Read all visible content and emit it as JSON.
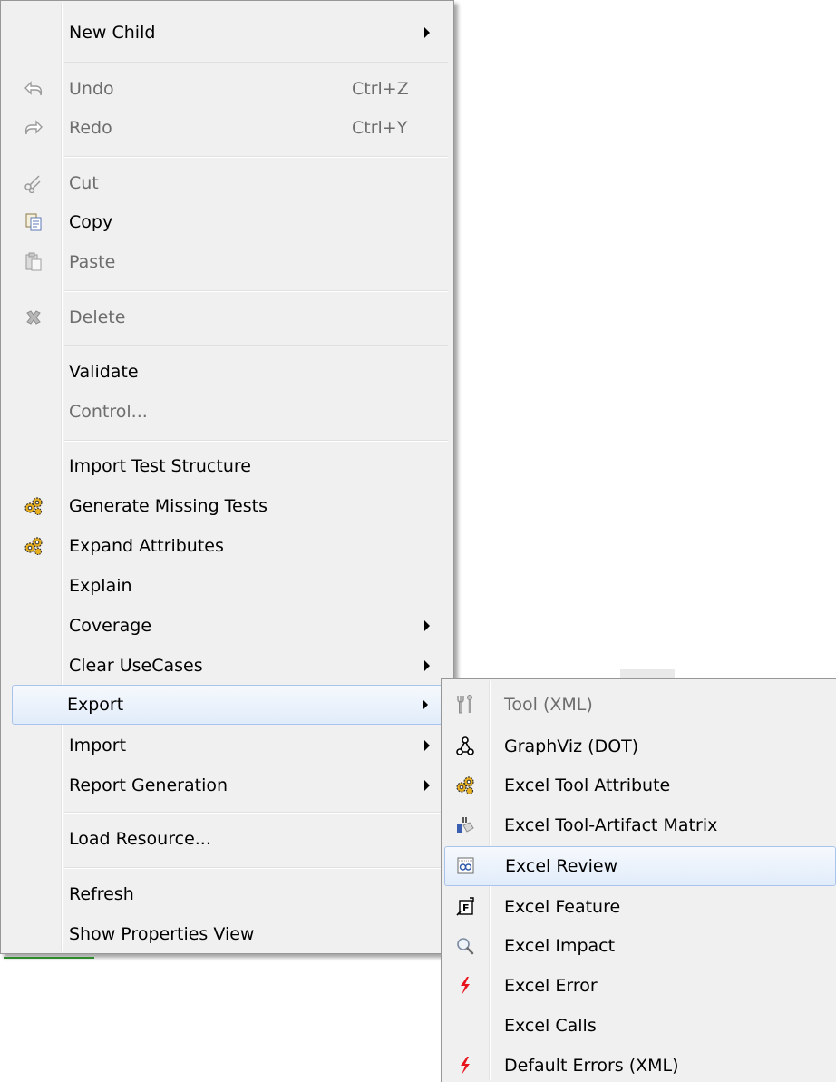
{
  "main_menu": {
    "items": [
      {
        "label": "New Child",
        "submenu": true
      },
      {
        "label": "Undo",
        "shortcut": "Ctrl+Z",
        "disabled": true,
        "icon": "undo-icon"
      },
      {
        "label": "Redo",
        "shortcut": "Ctrl+Y",
        "disabled": true,
        "icon": "redo-icon"
      },
      {
        "label": "Cut",
        "disabled": true,
        "icon": "scissors-icon"
      },
      {
        "label": "Copy",
        "icon": "copy-icon"
      },
      {
        "label": "Paste",
        "disabled": true,
        "icon": "paste-icon"
      },
      {
        "label": "Delete",
        "disabled": true,
        "icon": "delete-icon"
      },
      {
        "label": "Validate"
      },
      {
        "label": "Control...",
        "disabled": true
      },
      {
        "label": "Import Test Structure"
      },
      {
        "label": "Generate Missing Tests",
        "icon": "gears-icon"
      },
      {
        "label": "Expand Attributes",
        "icon": "gears-icon"
      },
      {
        "label": "Explain"
      },
      {
        "label": "Coverage",
        "submenu": true
      },
      {
        "label": "Clear UseCases",
        "submenu": true
      },
      {
        "label": "Export",
        "submenu": true,
        "highlighted": true
      },
      {
        "label": "Import",
        "submenu": true
      },
      {
        "label": "Report Generation",
        "submenu": true
      },
      {
        "label": "Load Resource..."
      },
      {
        "label": "Refresh"
      },
      {
        "label": "Show Properties View"
      }
    ]
  },
  "export_submenu": {
    "items": [
      {
        "label": "Tool (XML)",
        "disabled": true,
        "icon": "tool-icon"
      },
      {
        "label": "GraphViz (DOT)",
        "icon": "graph-icon"
      },
      {
        "label": "Excel Tool Attribute",
        "icon": "gears-icon"
      },
      {
        "label": "Excel Tool-Artifact Matrix",
        "icon": "matrix-icon"
      },
      {
        "label": "Excel Review",
        "icon": "review-icon",
        "highlighted": true
      },
      {
        "label": "Excel Feature",
        "icon": "feature-icon"
      },
      {
        "label": "Excel Impact",
        "icon": "magnifier-icon"
      },
      {
        "label": "Excel Error",
        "icon": "lightning-icon"
      },
      {
        "label": "Excel Calls"
      },
      {
        "label": "Default Errors (XML)",
        "icon": "lightning-icon"
      }
    ]
  },
  "colors": {
    "menu_bg": "#f0f0f0",
    "disabled_text": "#6d6d6d",
    "highlight_border": "#a8c4ea",
    "error_red": "#e8141b"
  }
}
